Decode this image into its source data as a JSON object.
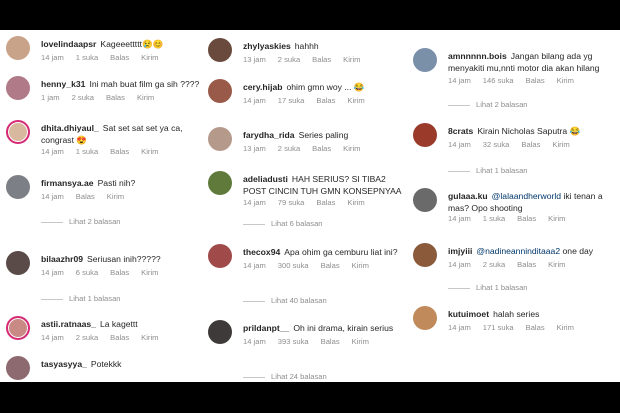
{
  "columns": [
    {
      "comments": [
        {
          "user": "lovelindaapsr",
          "text": "Kageeettttt😢😊",
          "time": "14 jam",
          "likes": "1 suka",
          "reply": "Balas",
          "send": "Kirim",
          "avatar": "#c9a28a"
        },
        {
          "user": "henny_k31",
          "text": "Ini mah buat film ga sih ????",
          "time": "1 jam",
          "likes": "2 suka",
          "reply": "Balas",
          "send": "Kirim",
          "avatar": "#b07a88"
        },
        {
          "user": "dhita.dhiyaul_",
          "text": "Sat set sat set ya ca, congrast 😍",
          "time": "14 jam",
          "likes": "1 suka",
          "reply": "Balas",
          "send": "Kirim",
          "avatar": "#d9b8a0",
          "story": true
        },
        {
          "user": "firmansya.ae",
          "text": "Pasti nih?",
          "time": "14 jam",
          "likes": "",
          "reply": "Balas",
          "send": "Kirim",
          "avatar": "#7d7f86",
          "replies": "Lihat 2 balasan"
        },
        {
          "user": "bilaazhr09",
          "text": "Seriusan inih?????",
          "time": "14 jam",
          "likes": "6 suka",
          "reply": "Balas",
          "send": "Kirim",
          "avatar": "#5a4a48",
          "replies": "Lihat 1 balasan"
        },
        {
          "user": "astii.ratnaas_",
          "text": "La kagettt",
          "time": "14 jam",
          "likes": "2 suka",
          "reply": "Balas",
          "send": "Kirim",
          "avatar": "#c98a86",
          "story": true
        },
        {
          "user": "tasyasyya_",
          "text": "Potekkk",
          "time": "",
          "likes": "",
          "reply": "",
          "send": "",
          "avatar": "#8c6a6f"
        }
      ]
    },
    {
      "comments": [
        {
          "user": "zhylyaskies",
          "text": "hahhh",
          "time": "13 jam",
          "likes": "2 suka",
          "reply": "Balas",
          "send": "Kirim",
          "avatar": "#6b4a3e"
        },
        {
          "user": "cery.hijab",
          "text": "ohim gmn woy ... 😂",
          "time": "14 jam",
          "likes": "17 suka",
          "reply": "Balas",
          "send": "Kirim",
          "avatar": "#9a5a4a"
        },
        {
          "user": "farydha_rida",
          "text": "Series paling",
          "time": "13 jam",
          "likes": "2 suka",
          "reply": "Balas",
          "send": "Kirim",
          "avatar": "#b59a8c"
        },
        {
          "user": "adeliadusti",
          "text": "HAH SERIUS? SI TIBA2 POST CINCIN TUH GMN KONSEPNYAA",
          "time": "14 jam",
          "likes": "79 suka",
          "reply": "Balas",
          "send": "Kirim",
          "avatar": "#5f7a3a",
          "replies": "Lihat 6 balasan"
        },
        {
          "user": "thecox94",
          "text": "Apa ohim ga cemburu liat ini?",
          "time": "14 jam",
          "likes": "300 suka",
          "reply": "Balas",
          "send": "Kirim",
          "avatar": "#a04a4a",
          "replies": "Lihat 40 balasan"
        },
        {
          "user": "prildanpt__",
          "text": "Oh ini drama, kirain serius",
          "time": "14 jam",
          "likes": "393 suka",
          "reply": "Balas",
          "send": "Kirim",
          "avatar": "#3e3a3a",
          "replies": "Lihat 24 balasan"
        }
      ]
    },
    {
      "comments": [
        {
          "user": "amnnnnn.bois",
          "text": "Jangan bilang ada yg menyakiti mu,nnti motor dia akan hilang",
          "time": "14 jam",
          "likes": "146 suka",
          "reply": "Balas",
          "send": "Kirim",
          "avatar": "#7a8fa8",
          "replies": "Lihat 2 balasan"
        },
        {
          "user": "8crats",
          "text": "Kirain Nicholas Saputra 😂",
          "time": "14 jam",
          "likes": "32 suka",
          "reply": "Balas",
          "send": "Kirim",
          "avatar": "#9a3a2a",
          "replies": "Lihat 1 balasan"
        },
        {
          "user": "gulaaa.ku",
          "mention": "@lalaandherworld",
          "text": "iki tenan a mas? Opo shooting",
          "time": "14 jam",
          "likes": "1 suka",
          "reply": "Balas",
          "send": "Kirim",
          "avatar": "#6a6a6a"
        },
        {
          "user": "imjyiii",
          "mention": "@nadineanninditaaa2",
          "text": "one day",
          "time": "14 jam",
          "likes": "2 suka",
          "reply": "Balas",
          "send": "Kirim",
          "avatar": "#8a5a3a",
          "replies": "Lihat 1 balasan"
        },
        {
          "user": "kutuimoet",
          "text": "halah series",
          "time": "14 jam",
          "likes": "171 suka",
          "reply": "Balas",
          "send": "Kirim",
          "avatar": "#c08a5a"
        }
      ]
    }
  ]
}
